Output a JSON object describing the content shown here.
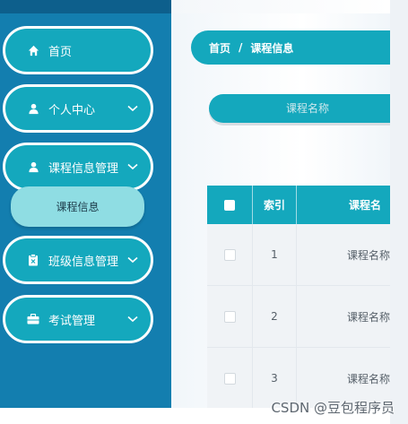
{
  "sidebar": {
    "items": [
      {
        "label": "首页",
        "icon": "home-icon",
        "has_chevron": false
      },
      {
        "label": "个人中心",
        "icon": "user-icon",
        "has_chevron": true
      },
      {
        "label": "课程信息管理",
        "icon": "user-icon",
        "has_chevron": true,
        "expanded": true
      },
      {
        "label": "班级信息管理",
        "icon": "clipboard-icon",
        "has_chevron": true
      },
      {
        "label": "考试管理",
        "icon": "briefcase-icon",
        "has_chevron": true
      }
    ],
    "subitem": {
      "label": "课程信息"
    }
  },
  "breadcrumb": {
    "home": "首页",
    "separator": "/",
    "current": "课程信息"
  },
  "search": {
    "placeholder": "课程名称"
  },
  "table": {
    "headers": {
      "index": "索引",
      "name": "课程名"
    },
    "rows": [
      {
        "index": "1",
        "name": "课程名称"
      },
      {
        "index": "2",
        "name": "课程名称"
      },
      {
        "index": "3",
        "name": "课程名称"
      }
    ]
  },
  "watermark": "CSDN @豆包程序员",
  "colors": {
    "accent": "#14a8bd",
    "sidebar": "#137eaf",
    "submenu": "#8fdde3"
  }
}
